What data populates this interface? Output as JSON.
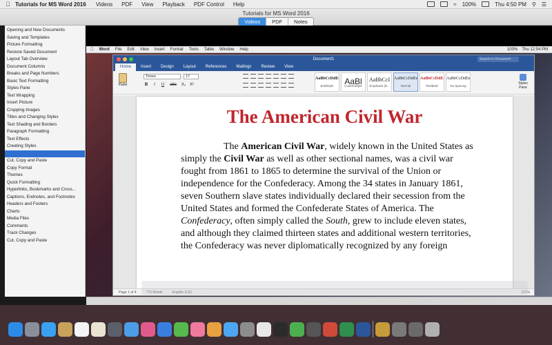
{
  "menubar": {
    "app_name": "Tutorials for MS Word 2016",
    "items": [
      "Videos",
      "PDF",
      "View",
      "Playback",
      "PDF Control",
      "Help"
    ],
    "battery": "100%",
    "clock": "Thu 4:50 PM"
  },
  "window": {
    "title": "Tutorials for MS Word 2016",
    "tabs": [
      {
        "label": "Videos",
        "active": true
      },
      {
        "label": "PDF",
        "active": false
      },
      {
        "label": "Notes",
        "active": false
      }
    ]
  },
  "lessons": [
    "Opening and New Documents",
    "Saving and Templates",
    "Picture Formatting",
    "Restore Saved Document",
    "Layout Tab Overview",
    "Document Columns",
    "Breaks and Page Numbers",
    "Basic Text Formatting",
    "Styles Pane",
    "Text Wrapping",
    "Insert Picture",
    "Cropping Images",
    "Titles and Changing Styles",
    "Text Shading and Borders",
    "Paragraph Formatting",
    "Text Effects",
    "Creating Styles",
    "",
    "Cut, Copy and Paste",
    "Copy Format",
    "Themes",
    "Quick Formatting",
    "Hyperlinks, Bookmarks and Cross...",
    "Captions, Endnotes, and Footnotes",
    "Headers and Footers",
    "Charts",
    "Media Files",
    "Comments",
    "Track Changes",
    "Cut, Copy and Paste"
  ],
  "selected_lesson_index": 17,
  "video": {
    "inner_menubar": {
      "app": "Word",
      "items": [
        "File",
        "Edit",
        "View",
        "Insert",
        "Format",
        "Tools",
        "Table",
        "Window",
        "Help"
      ],
      "battery": "100%",
      "clock": "Thu 12:54 PM"
    },
    "word": {
      "doc_name": "Document1",
      "search_placeholder": "Search in Document",
      "tabs": [
        {
          "label": "Home",
          "active": true
        },
        {
          "label": "Insert",
          "active": false
        },
        {
          "label": "Design",
          "active": false
        },
        {
          "label": "Layout",
          "active": false
        },
        {
          "label": "References",
          "active": false
        },
        {
          "label": "Mailings",
          "active": false
        },
        {
          "label": "Review",
          "active": false
        },
        {
          "label": "View",
          "active": false
        }
      ],
      "paste_label": "Paste",
      "font": "Times",
      "font_size": "17",
      "format_buttons": [
        "B",
        "I",
        "U",
        "abc",
        "X₂",
        "X²"
      ],
      "styles": [
        {
          "sample": "AaBbCcDdEe",
          "name": "BoldStyle"
        },
        {
          "sample": "AaBl",
          "name": "CustomStyle"
        },
        {
          "sample": "AaBbCcI",
          "name": "Emphasis (B..."
        },
        {
          "sample": "AaBbCcDdEe",
          "name": "Normal"
        },
        {
          "sample": "AaBbCcDdEe",
          "name": "RedBold"
        },
        {
          "sample": "AaBbCcDdEe",
          "name": "No Spacing"
        }
      ],
      "styles_pane_label": "Styles Pane",
      "title": "The American Civil War",
      "status": {
        "page": "Page 1 of 4",
        "words": "776 Words",
        "language": "English (US)",
        "zoom": "151%"
      }
    }
  },
  "colors": {
    "word_blue": "#2b579a",
    "selection_blue": "#2f6fd1",
    "title_red": "#c0262d"
  }
}
